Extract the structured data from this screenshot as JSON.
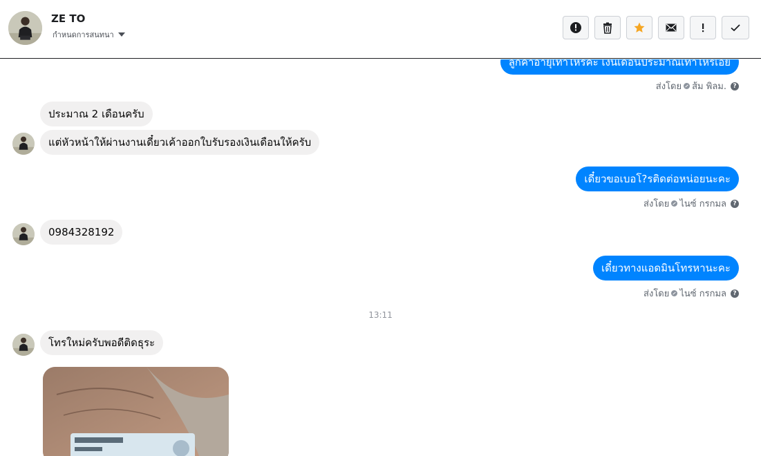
{
  "header": {
    "contact_name": "ZE TO",
    "assign_label": "กำหนดการสนทนา",
    "actions": [
      "spam-icon",
      "trash-icon",
      "star-icon",
      "mail-icon",
      "exclaim-icon",
      "check-icon"
    ]
  },
  "messages": {
    "out1": {
      "text": "ลูกค้าอายุเท่าไหร่คะ เงินเดือนประมาณเท่าไหร่เอ่ย",
      "sent_by": "ส่งโดย",
      "agent": "ส้ม พิลม."
    },
    "in1": {
      "text": "ประมาณ 2 เดือนครับ"
    },
    "in2": {
      "text": "แต่หัวหน้าให้ผ่านงานเดี๋ยวเค้าออกใบรับรองเงินเดือนให้ครับ"
    },
    "out2": {
      "text": "เดี๋ยวขอเบอโ?รติดต่อหน่อยนะคะ",
      "sent_by": "ส่งโดย",
      "agent": "ไนซ์ กรกมล"
    },
    "in3": {
      "text": "0984328192"
    },
    "out3": {
      "text": "เดี๋ยวทางแอดมินโทรหานะคะ",
      "sent_by": "ส่งโดย",
      "agent": "ไนซ์ กรกมล"
    },
    "time": "13:11",
    "in4": {
      "text": "โทรใหม่ครับพอดีติดธุระ"
    }
  },
  "colors": {
    "brand": "#0084ff",
    "incoming": "#f1f0f0",
    "star": "#f5a623"
  }
}
